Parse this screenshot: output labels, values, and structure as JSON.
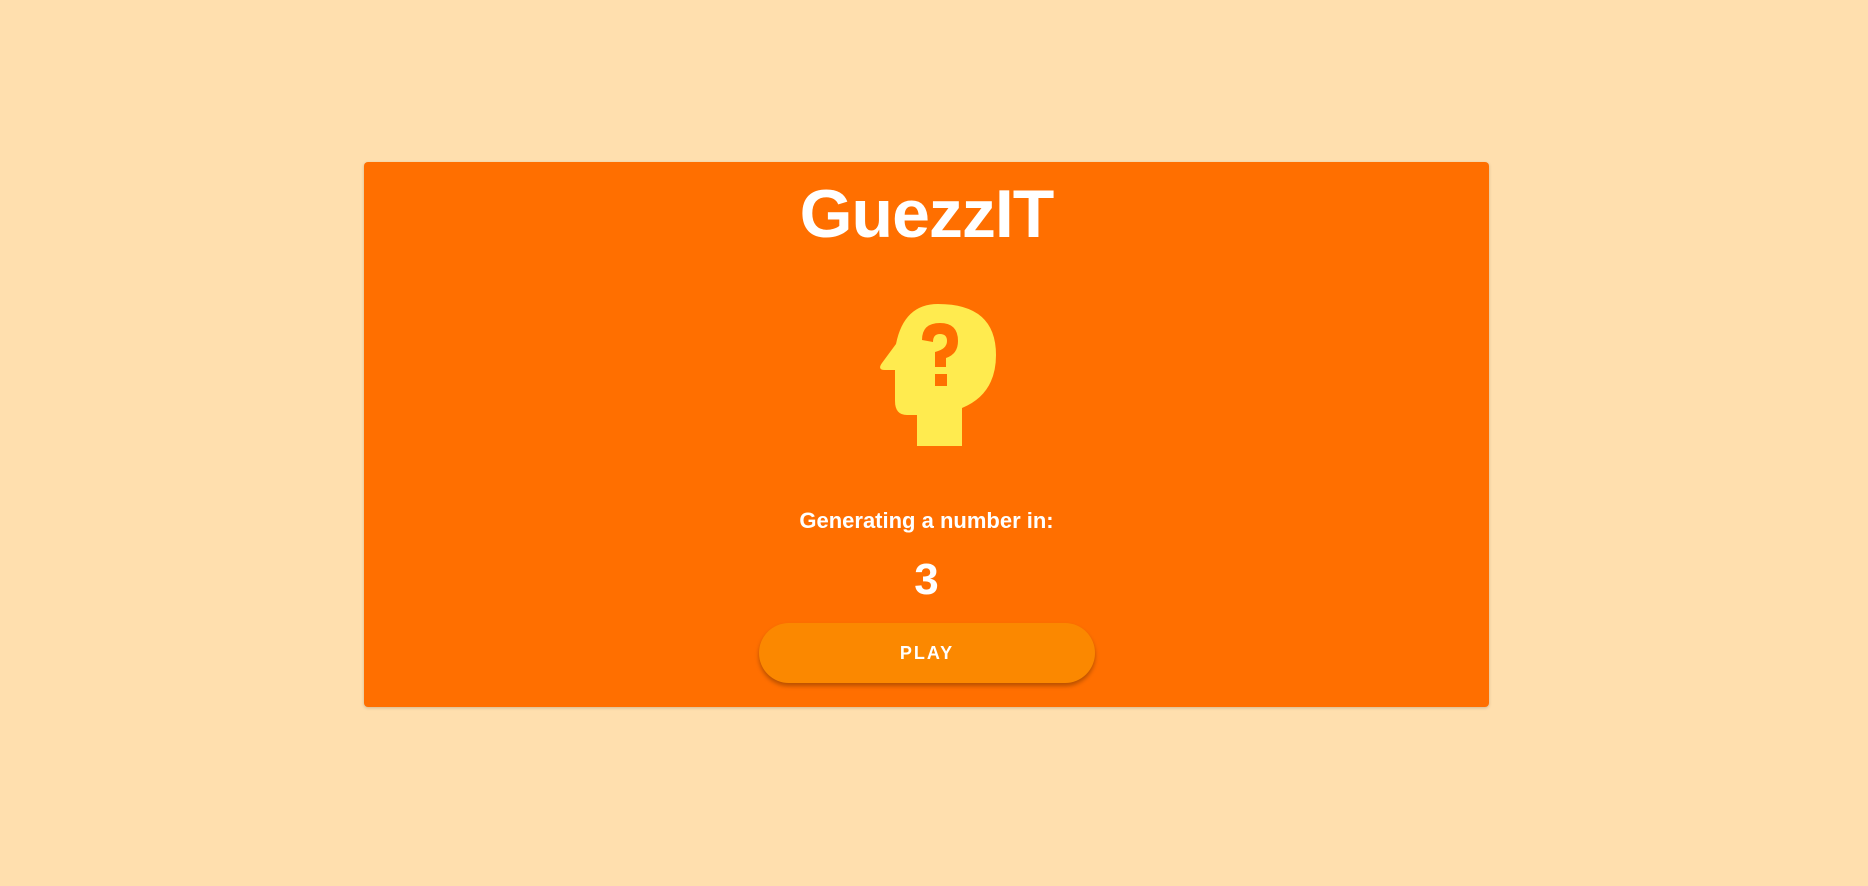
{
  "app": {
    "title": "GuezzIT"
  },
  "game": {
    "status_label": "Generating a number in:",
    "countdown": "3",
    "play_label": "PLAY"
  },
  "icons": {
    "hero": "psychology-question-head-icon"
  },
  "colors": {
    "page_background": "#ffdfae",
    "card_background": "#ff6f00",
    "icon_fill": "#ffeb4f",
    "button_background": "#fb8800",
    "text": "#ffffff"
  }
}
